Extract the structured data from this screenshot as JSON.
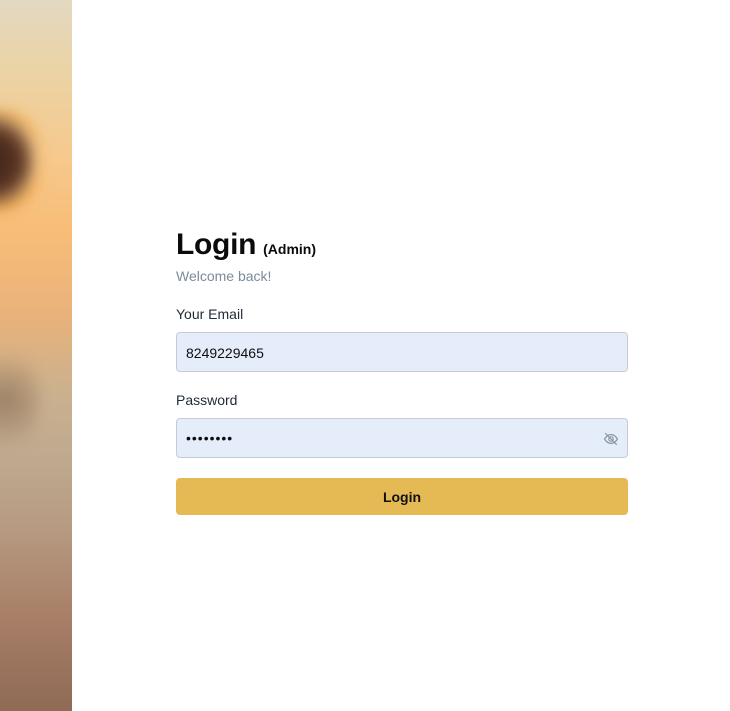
{
  "side_image": {
    "kind": "blurred-photo"
  },
  "login": {
    "title": "Login",
    "role": "(Admin)",
    "welcome": "Welcome back!",
    "email_label": "Your Email",
    "email_value": "8249229465",
    "password_label": "Password",
    "password_value": "••••••••",
    "password_toggle_icon": "eye-off-icon",
    "submit_label": "Login"
  },
  "colors": {
    "accent": "#e5ba55",
    "input_bg": "#e5ecfa",
    "muted_text": "#7b8b9a"
  }
}
